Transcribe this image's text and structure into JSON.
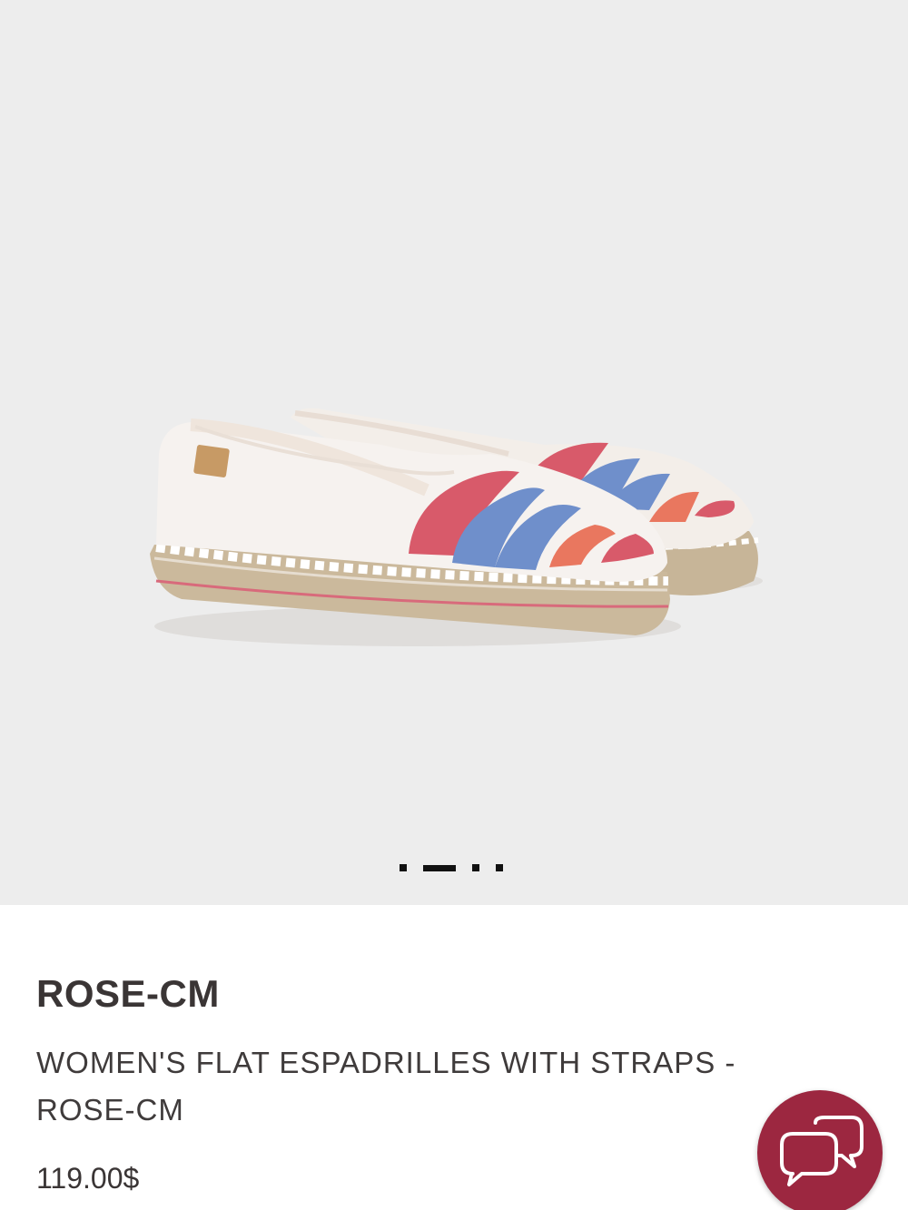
{
  "product": {
    "brand": "ROSE-CM",
    "name": "WOMEN'S FLAT ESPADRILLES WITH STRAPS - ROSE-CM",
    "price": "119.00$",
    "image_alt": "Women's flat espadrilles with straps"
  },
  "gallery": {
    "background": "#ededed",
    "slide_count": 4,
    "active_slide": 2
  },
  "chat": {
    "icon": "chat-bubbles-icon",
    "color": "#9c2740"
  }
}
